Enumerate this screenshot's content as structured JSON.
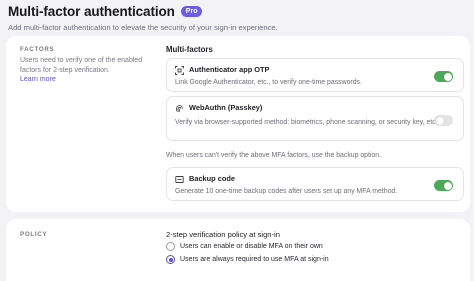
{
  "header": {
    "title": "Multi-factor authentication",
    "badge": "Pro",
    "subtitle": "Add multi-factor authentication to elevate the security of your sign-in experience."
  },
  "factors_section": {
    "label": "FACTORS",
    "description": "Users need to verify one of the enabled factors for 2-step verification.",
    "learn_more": "Learn more",
    "list_title": "Multi-factors",
    "items": [
      {
        "name": "Authenticator app OTP",
        "description": "Link Google Authenticator, etc., to verify one-time passwords.",
        "icon": "qr-scan-icon",
        "enabled": true
      },
      {
        "name": "WebAuthn (Passkey)",
        "description": "Verify via browser-supported method: biometrics, phone scanning, or security key, etc.",
        "icon": "fingerprint-icon",
        "enabled": false
      }
    ],
    "backup_note": "When users can't verify the above MFA factors, use the backup option.",
    "backup": {
      "name": "Backup code",
      "description": "Generate 10 one-time backup codes after users set up any MFA method.",
      "icon": "backup-code-icon",
      "enabled": true
    }
  },
  "policy_section": {
    "label": "POLICY",
    "title": "2-step verification policy at sign-in",
    "options": [
      {
        "label": "Users can enable or disable MFA on their own",
        "selected": false
      },
      {
        "label": "Users are always required to use MFA at sign-in",
        "selected": true
      }
    ]
  },
  "colors": {
    "accent": "#5b4fd6",
    "badge": "#6c5ce7",
    "toggle_on": "#4ea957",
    "toggle_off": "#e3e3e8"
  }
}
